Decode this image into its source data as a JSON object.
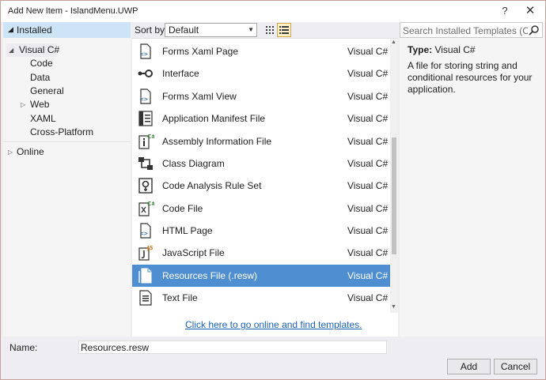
{
  "window": {
    "title": "Add New Item - IslandMenu.UWP",
    "help_label": "?",
    "close_label": "✕"
  },
  "sidebar": {
    "installed_label": "Installed",
    "items": [
      {
        "label": "Visual C#"
      },
      {
        "label": "Code"
      },
      {
        "label": "Data"
      },
      {
        "label": "General"
      },
      {
        "label": "Web"
      },
      {
        "label": "XAML"
      },
      {
        "label": "Cross-Platform"
      }
    ],
    "online_label": "Online"
  },
  "toolbar": {
    "sort_label": "Sort by:",
    "sort_value": "Default"
  },
  "templates": [
    {
      "name": "Forms Xaml Page",
      "lang": "Visual C#",
      "icon": "forms-xaml-icon"
    },
    {
      "name": "Interface",
      "lang": "Visual C#",
      "icon": "interface-icon"
    },
    {
      "name": "Forms Xaml View",
      "lang": "Visual C#",
      "icon": "forms-xaml-icon"
    },
    {
      "name": "Application Manifest File",
      "lang": "Visual C#",
      "icon": "manifest-icon"
    },
    {
      "name": "Assembly Information File",
      "lang": "Visual C#",
      "icon": "assembly-info-icon"
    },
    {
      "name": "Class Diagram",
      "lang": "Visual C#",
      "icon": "class-diagram-icon"
    },
    {
      "name": "Code Analysis Rule Set",
      "lang": "Visual C#",
      "icon": "rule-set-icon"
    },
    {
      "name": "Code File",
      "lang": "Visual C#",
      "icon": "code-file-icon"
    },
    {
      "name": "HTML Page",
      "lang": "Visual C#",
      "icon": "html-icon"
    },
    {
      "name": "JavaScript File",
      "lang": "Visual C#",
      "icon": "javascript-icon"
    },
    {
      "name": "Resources File (.resw)",
      "lang": "Visual C#",
      "icon": "resources-file-icon",
      "selected": true
    },
    {
      "name": "Text File",
      "lang": "Visual C#",
      "icon": "text-file-icon"
    }
  ],
  "online_link": "Click here to go online and find templates.",
  "search": {
    "placeholder": "Search Installed Templates (Ctrl+E)"
  },
  "details": {
    "type_label": "Type:",
    "type_value": "Visual C#",
    "description": "A file for storing string and conditional resources for your application."
  },
  "footer": {
    "name_label": "Name:",
    "name_value": "Resources.resw",
    "add_label": "Add",
    "cancel_label": "Cancel"
  },
  "colors": {
    "selection": "#4f8fd1",
    "installed_header": "#cce4f6",
    "link": "#1a5fb4"
  }
}
